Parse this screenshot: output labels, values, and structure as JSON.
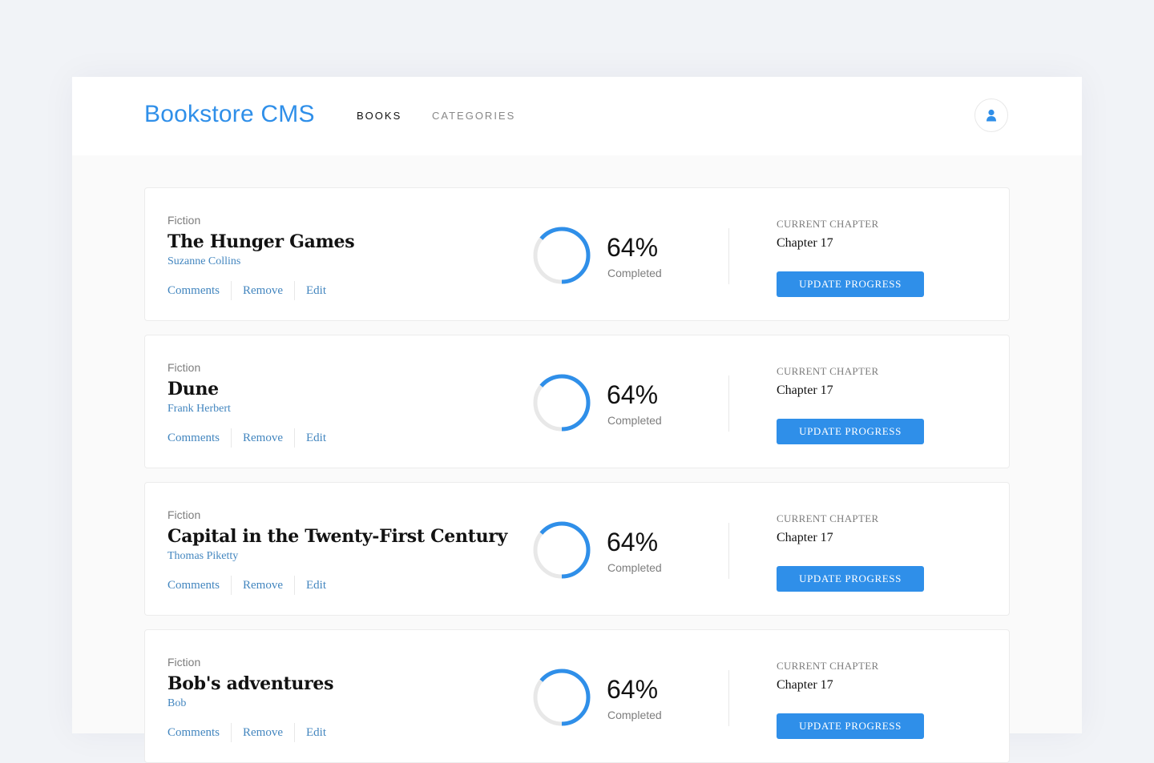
{
  "header": {
    "logo": "Bookstore CMS",
    "nav": [
      {
        "label": "BOOKS",
        "active": true
      },
      {
        "label": "CATEGORIES",
        "active": false
      }
    ],
    "avatar_icon": "user-icon"
  },
  "books": [
    {
      "genre": "Fiction",
      "title": "The Hunger Games",
      "author": "Suzanne Collins",
      "actions": [
        "Comments",
        "Remove",
        "Edit"
      ],
      "progress": 64,
      "progress_text": "64%",
      "progress_label": "Completed",
      "current_chapter_label": "CURRENT CHAPTER",
      "current_chapter": "Chapter 17",
      "update_button": "UPDATE PROGRESS"
    },
    {
      "genre": "Fiction",
      "title": "Dune",
      "author": "Frank Herbert",
      "actions": [
        "Comments",
        "Remove",
        "Edit"
      ],
      "progress": 64,
      "progress_text": "64%",
      "progress_label": "Completed",
      "current_chapter_label": "CURRENT CHAPTER",
      "current_chapter": "Chapter 17",
      "update_button": "UPDATE PROGRESS"
    },
    {
      "genre": "Fiction",
      "title": "Capital in the Twenty-First Century",
      "author": "Thomas Piketty",
      "actions": [
        "Comments",
        "Remove",
        "Edit"
      ],
      "progress": 64,
      "progress_text": "64%",
      "progress_label": "Completed",
      "current_chapter_label": "CURRENT CHAPTER",
      "current_chapter": "Chapter 17",
      "update_button": "UPDATE PROGRESS"
    },
    {
      "genre": "Fiction",
      "title": "Bob's adventures",
      "author": "Bob",
      "actions": [
        "Comments",
        "Remove",
        "Edit"
      ],
      "progress": 64,
      "progress_text": "64%",
      "progress_label": "Completed",
      "current_chapter_label": "CURRENT CHAPTER",
      "current_chapter": "Chapter 17",
      "update_button": "UPDATE PROGRESS"
    }
  ],
  "colors": {
    "accent": "#2f8fe9",
    "link": "#4386bf",
    "ring_track": "#e8e8e8",
    "page_bg": "#f1f3f7"
  }
}
